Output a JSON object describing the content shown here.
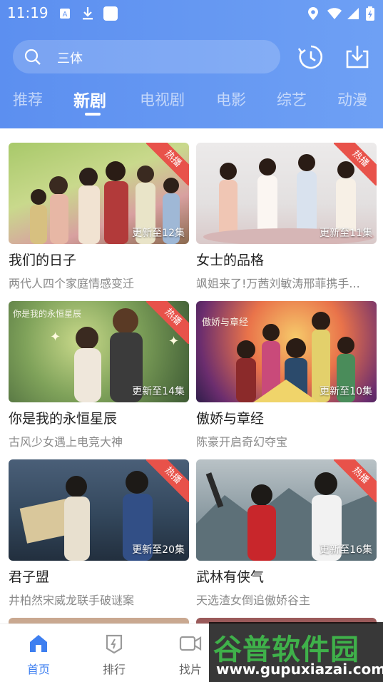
{
  "status_bar": {
    "time": "11:19"
  },
  "search": {
    "query": "三体"
  },
  "tabs": [
    {
      "label": "推荐",
      "active": false
    },
    {
      "label": "新剧",
      "active": true
    },
    {
      "label": "电视剧",
      "active": false
    },
    {
      "label": "电影",
      "active": false
    },
    {
      "label": "综艺",
      "active": false
    },
    {
      "label": "动漫",
      "active": false
    }
  ],
  "cards": [
    {
      "title": "我们的日子",
      "subtitle": "两代人四个家庭情感变迁",
      "badge": "热播",
      "update": "更新至12集"
    },
    {
      "title": "女士的品格",
      "subtitle": "飒姐来了!万茜刘敏涛邢菲携手...",
      "badge": "热播",
      "update": "更新至11集"
    },
    {
      "title": "你是我的永恒星辰",
      "subtitle": "古风少女遇上电竞大神",
      "badge": "热播",
      "update": "更新至14集"
    },
    {
      "title": "傲娇与章经",
      "subtitle": "陈豪开启奇幻夺宝",
      "badge": "",
      "update": "更新至10集"
    },
    {
      "title": "君子盟",
      "subtitle": "井柏然宋威龙联手破谜案",
      "badge": "热播",
      "update": "更新至20集"
    },
    {
      "title": "武林有侠气",
      "subtitle": "天选渣女倒追傲娇谷主",
      "badge": "热播",
      "update": "更新至16集"
    }
  ],
  "bottom_nav": [
    {
      "label": "首页",
      "icon": "home-icon",
      "active": true
    },
    {
      "label": "排行",
      "icon": "ranking-icon",
      "active": false
    },
    {
      "label": "找片",
      "icon": "video-icon",
      "active": false
    }
  ],
  "watermark": {
    "brand": "谷普软件园",
    "url": "www.gupuxiazai.com"
  },
  "colors": {
    "header_start": "#5c8ff0",
    "header_end": "#6ea0f4",
    "accent": "#3e7ff0",
    "badge": "#e8524a"
  }
}
